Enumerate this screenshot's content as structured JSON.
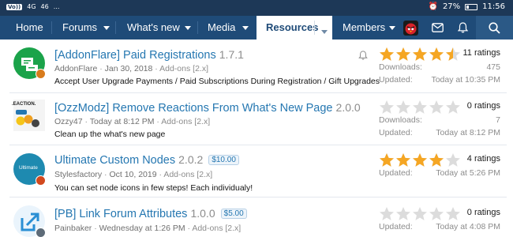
{
  "status_bar": {
    "left_chips": [
      "Vo))",
      "4G",
      "46",
      "..."
    ],
    "battery": "27%",
    "battery_level": 0.27,
    "time": "11:56"
  },
  "nav": {
    "home": "Home",
    "forums": "Forums",
    "whats_new": "What's new",
    "media": "Media",
    "resources": "Resources",
    "members": "Members"
  },
  "resources": [
    {
      "title": "[AddonFlare] Paid Registrations",
      "version": "1.7.1",
      "price": "",
      "author": "AddonFlare",
      "date": "Jan 30, 2018",
      "category": "Add-ons [2.x]",
      "description": "Accept User Upgrade Payments / Paid Subscriptions During Registration / Gift Upgrades",
      "rating": 4.5,
      "ratings_label": "11 ratings",
      "downloads_label": "Downloads:",
      "downloads": "475",
      "updated_label": "Updated:",
      "updated": "Today at 10:35 PM",
      "icon": "addonflare-logo-icon",
      "icon_color": "#1ba34a"
    },
    {
      "title": "[OzzModz] Remove Reactions From What's New Page",
      "version": "2.0.0",
      "price": "",
      "author": "Ozzy47",
      "date": "Today at 8:12 PM",
      "category": "Add-ons [2.x]",
      "description": "Clean up the what's new page",
      "rating": 0,
      "ratings_label": "0 ratings",
      "downloads_label": "Downloads:",
      "downloads": "7",
      "updated_label": "Updated:",
      "updated": "Today at 8:12 PM",
      "icon": "reactions-icon",
      "icon_text": ".EACTION.",
      "icon_color": "#f4f4f4"
    },
    {
      "title": "Ultimate Custom Nodes",
      "version": "2.0.2",
      "price": "$10.00",
      "author": "Stylesfactory",
      "date": "Oct 10, 2019",
      "category": "Add-ons [2.x]",
      "description": "You can set node icons in few steps! Each individualy!",
      "rating": 4,
      "ratings_label": "4 ratings",
      "downloads_label": "",
      "downloads": "",
      "updated_label": "Updated:",
      "updated": "Today at 5:26 PM",
      "icon": "ultimate-logo-icon",
      "icon_text": "Ultimate",
      "icon_color": "#1e8ab0"
    },
    {
      "title": "[PB] Link Forum Attributes",
      "version": "1.0.0",
      "price": "$5.00",
      "author": "Painbaker",
      "date": "Wednesday at 1:26 PM",
      "category": "Add-ons [2.x]",
      "description": "",
      "rating": 0,
      "ratings_label": "0 ratings",
      "downloads_label": "",
      "downloads": "",
      "updated_label": "Updated:",
      "updated": "Today at 4:08 PM",
      "icon": "external-link-icon",
      "icon_color": "#2a8fd4"
    }
  ],
  "colors": {
    "nav_bg": "#1f4b78",
    "status_bg": "#1d3857",
    "link": "#2577b1",
    "star_full": "#f5a623",
    "star_empty": "#dcdcdc"
  }
}
